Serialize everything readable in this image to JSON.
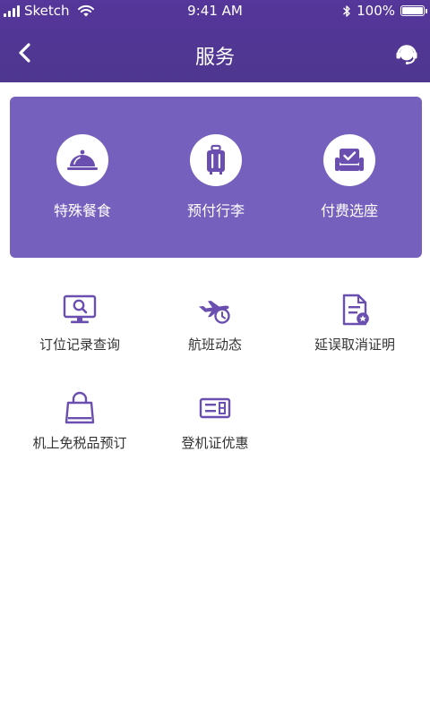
{
  "status_bar": {
    "carrier": "Sketch",
    "time": "9:41 AM",
    "battery": "100%"
  },
  "nav": {
    "title": "服务"
  },
  "featured": [
    {
      "label": "特殊餐食",
      "icon": "food-cloche-icon"
    },
    {
      "label": "预付行李",
      "icon": "luggage-icon"
    },
    {
      "label": "付费选座",
      "icon": "seat-icon"
    }
  ],
  "services": [
    {
      "label": "订位记录查询",
      "icon": "monitor-search-icon"
    },
    {
      "label": "航班动态",
      "icon": "flight-clock-icon"
    },
    {
      "label": "延误取消证明",
      "icon": "certificate-icon"
    },
    {
      "label": "机上免税品预订",
      "icon": "shopping-bag-icon"
    },
    {
      "label": "登机证优惠",
      "icon": "boarding-pass-icon"
    }
  ],
  "colors": {
    "header": "#55369a",
    "card": "#7660bd",
    "icon": "#6a4fb0"
  }
}
